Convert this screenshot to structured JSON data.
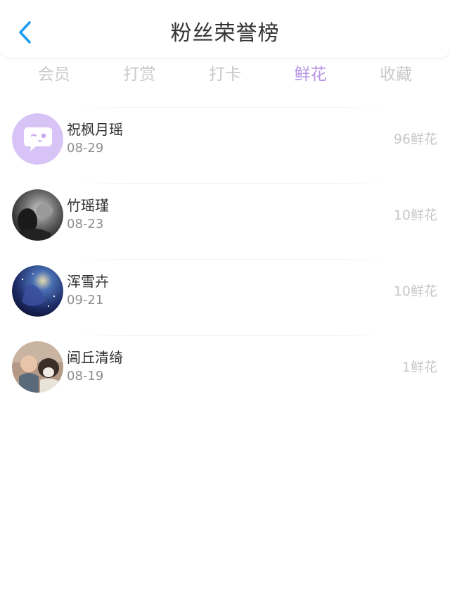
{
  "header": {
    "title": "粉丝荣誉榜",
    "back_icon": "chevron-left-icon",
    "back_color": "#1e9bf0"
  },
  "tabs": [
    {
      "label": "会员",
      "active": false
    },
    {
      "label": "打赏",
      "active": false
    },
    {
      "label": "打卡",
      "active": false
    },
    {
      "label": "鲜花",
      "active": true
    },
    {
      "label": "收藏",
      "active": false
    }
  ],
  "accent_color": "#b693e4",
  "fans": [
    {
      "name": "祝枫月瑶",
      "date": "08-29",
      "amount": "96鲜花",
      "avatar": "default-chat-avatar"
    },
    {
      "name": "竹瑶瑾",
      "date": "08-23",
      "amount": "10鲜花",
      "avatar": "photo-avatar-dark"
    },
    {
      "name": "浑雪卉",
      "date": "09-21",
      "amount": "10鲜花",
      "avatar": "photo-avatar-night-sky"
    },
    {
      "name": "阊丘清绮",
      "date": "08-19",
      "amount": "1鲜花",
      "avatar": "photo-avatar-baby-dog"
    }
  ]
}
